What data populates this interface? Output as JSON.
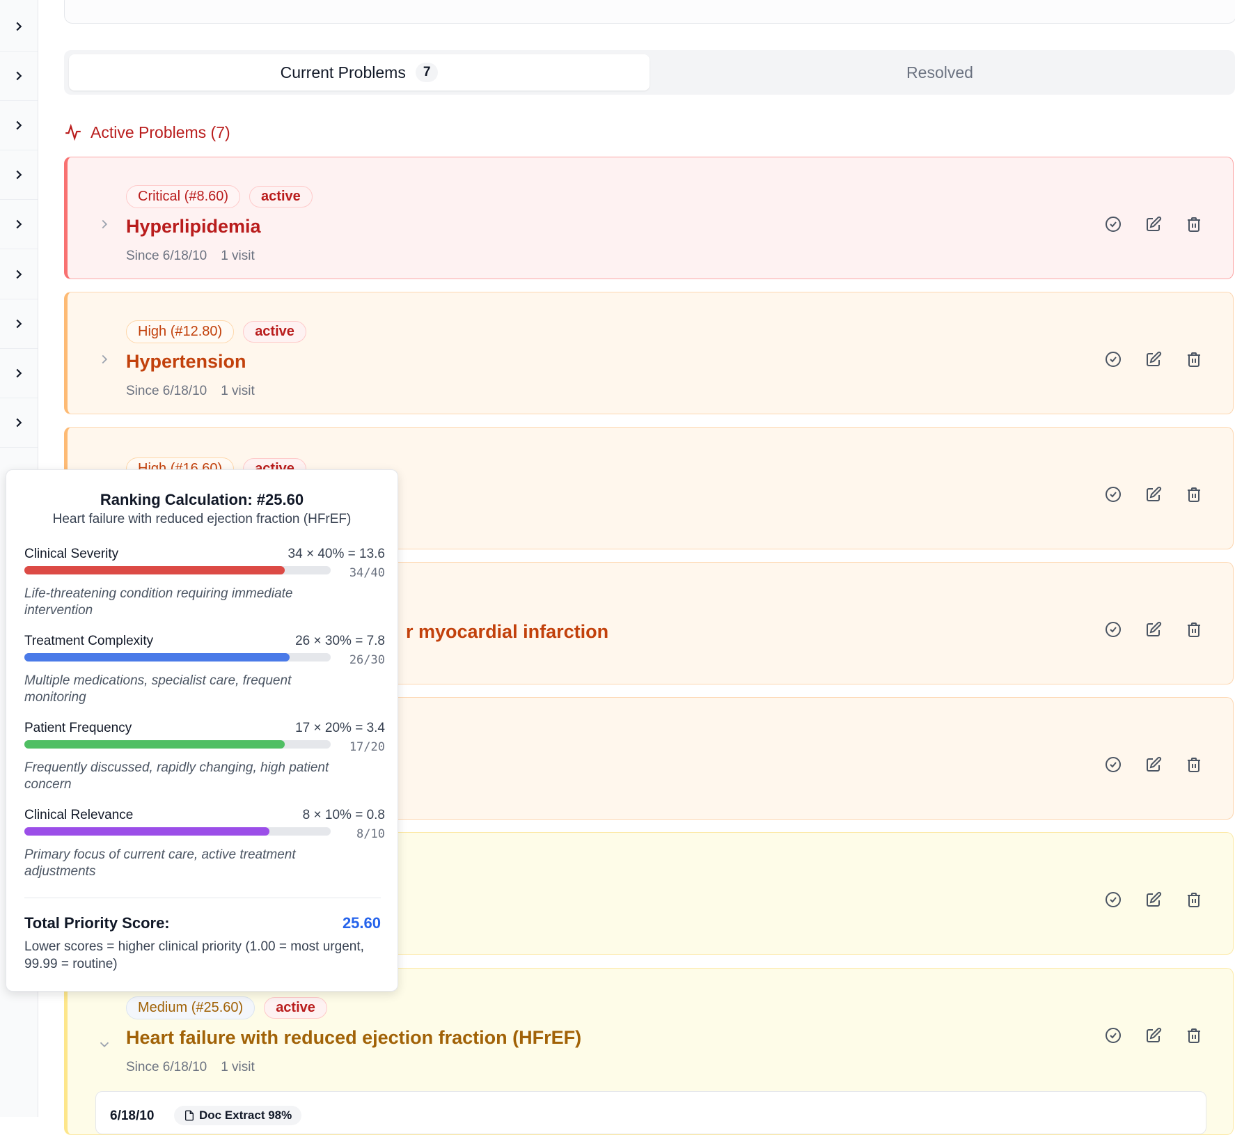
{
  "tabs": {
    "current_label": "Current Problems",
    "current_count": "7",
    "resolved_label": "Resolved"
  },
  "section": {
    "title": "Active Problems (7)"
  },
  "problems": [
    {
      "severity": "Critical (#8.60)",
      "status": "active",
      "title": "Hyperlipidemia",
      "since": "Since 6/18/10",
      "visits": "1 visit"
    },
    {
      "severity": "High (#12.80)",
      "status": "active",
      "title": "Hypertension",
      "since": "Since 6/18/10",
      "visits": "1 visit"
    },
    {
      "severity": "High (#16.60)",
      "status": "active"
    },
    {
      "title_partial": "r myocardial infarction"
    },
    {},
    {},
    {
      "severity": "Medium (#25.60)",
      "status": "active",
      "title": "Heart failure with reduced ejection fraction (HFrEF)",
      "since": "Since 6/18/10",
      "visits": "1 visit",
      "detail": {
        "date": "6/18/10",
        "source": "Doc Extract 98%"
      }
    }
  ],
  "tooltip": {
    "title": "Ranking Calculation: #25.60",
    "subtitle": "Heart failure with reduced ejection fraction (HFrEF)",
    "factors": [
      {
        "name": "Clinical Severity",
        "calc": "34 × 40% = 13.6",
        "ratio": "34/40",
        "fraction": 0.85,
        "color": "#dc4a45",
        "desc": "Life-threatening condition requiring immediate intervention"
      },
      {
        "name": "Treatment Complexity",
        "calc": "26 × 30% = 7.8",
        "ratio": "26/30",
        "fraction": 0.8667,
        "color": "#4a7ae8",
        "desc": "Multiple medications, specialist care, frequent monitoring"
      },
      {
        "name": "Patient Frequency",
        "calc": "17 × 20% = 3.4",
        "ratio": "17/20",
        "fraction": 0.85,
        "color": "#4fbf63",
        "desc": "Frequently discussed, rapidly changing, high patient concern"
      },
      {
        "name": "Clinical Relevance",
        "calc": "8 × 10% = 0.8",
        "ratio": "8/10",
        "fraction": 0.8,
        "color": "#9b4ee8",
        "desc": "Primary focus of current care, active treatment adjustments"
      }
    ],
    "total_label": "Total Priority Score:",
    "total_value": "25.60",
    "note": "Lower scores = higher clinical priority (1.00 = most urgent, 99.99 = routine)"
  }
}
